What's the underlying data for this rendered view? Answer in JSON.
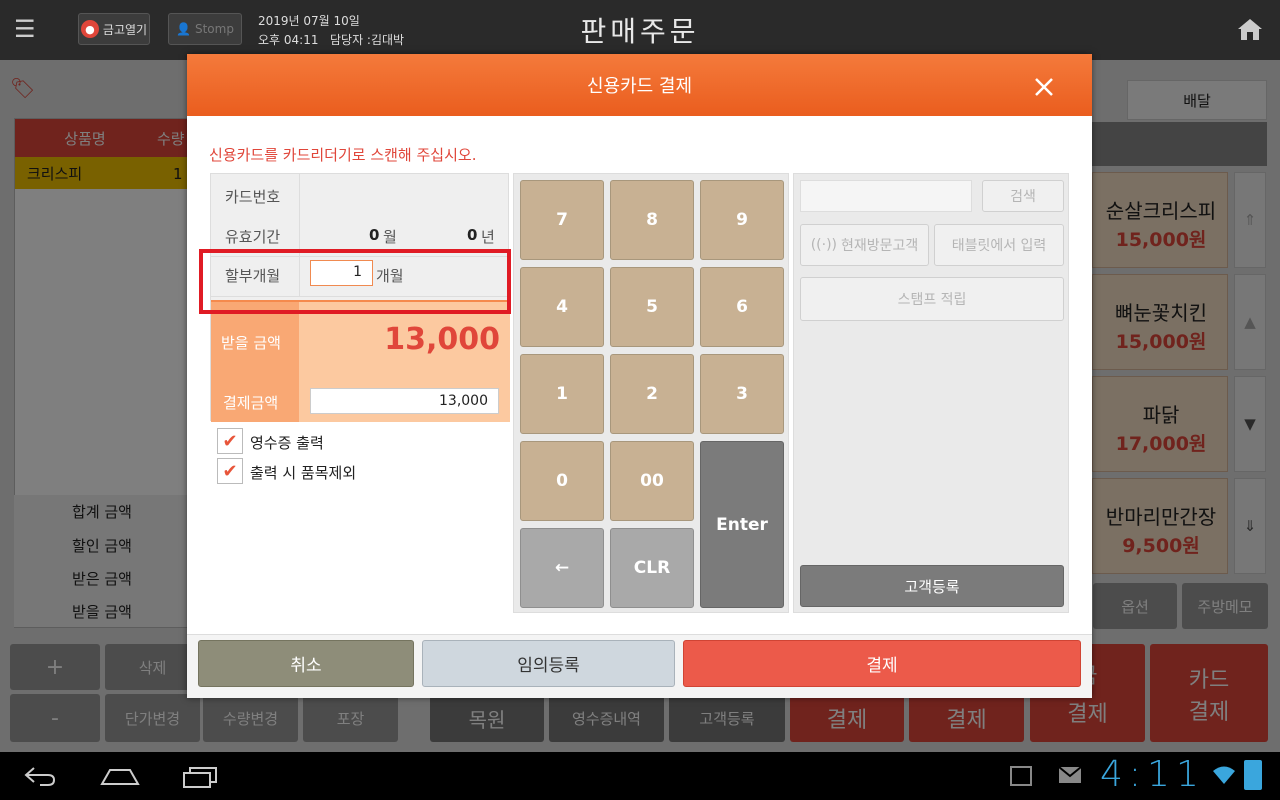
{
  "topbar": {
    "grabber_label": "금고열기",
    "stamp_label": "Stomp",
    "date": "2019년 07월 10일",
    "time": "오후 04:11",
    "staff": "담당자 :김대박",
    "title": "판매주문"
  },
  "background": {
    "tab_delivery": "배달",
    "table_headers": [
      "상품명",
      "수량"
    ],
    "order_row": {
      "name": "크리스피",
      "qty": "1"
    },
    "totals": [
      "합계 금액",
      "할인 금액",
      "받은 금액",
      "받을 금액"
    ],
    "menu_items": [
      {
        "name": "순살크리스피",
        "price": "15,000원"
      },
      {
        "name": "뼈눈꽃치킨",
        "price": "15,000원"
      },
      {
        "name": "파닭",
        "price": "17,000원"
      },
      {
        "name": "반마리만간장",
        "price": "9,500원"
      }
    ],
    "buttons": {
      "plus": "+",
      "minus": "-",
      "delete": "삭제",
      "unit_price": "단가변경",
      "qty_change": "수량변경",
      "pack": "포장",
      "restore": "목원",
      "receipt_history": "영수증내역",
      "customer_reg": "고객등록",
      "option": "옵션",
      "kitchen_memo": "주방메모",
      "pay1": "결제",
      "pay2": "결제",
      "pay3_top": "금",
      "pay3": "결제",
      "card_top": "카드",
      "card": "결제"
    }
  },
  "modal": {
    "title": "신용카드 결제",
    "instruction": "신용카드를 카드리더기로 스캔해 주십시오.",
    "card_number_label": "카드번호",
    "expiry_label": "유효기간",
    "expiry_month": "0",
    "month_unit": "월",
    "expiry_year": "0",
    "year_unit": "년",
    "installment_label": "할부개월",
    "installment_value": "1",
    "installment_unit": "개월",
    "receivable_label": "받을 금액",
    "receivable_amount": "13,000",
    "payment_label": "결제금액",
    "payment_amount": "13,000",
    "receipt_print": "영수증 출력",
    "exclude_items": "출력 시 품목제외",
    "keys": [
      "7",
      "8",
      "9",
      "4",
      "5",
      "6",
      "1",
      "2",
      "3",
      "0",
      "00",
      "Enter",
      "←",
      "CLR"
    ],
    "search_placeholder": "",
    "search_button": "검색",
    "current_customer": "현재방문고객",
    "tablet_input": "태블릿에서 입력",
    "stamp_earn": "스탬프 적립",
    "register_customer": "고객등록",
    "cancel": "취소",
    "arbitrary_reg": "임의등록",
    "pay": "결제"
  },
  "navbar": {
    "clock": "4:11"
  },
  "colors": {
    "accent": "#ea5d1e",
    "highlight_box": "#e01b24",
    "amount_red": "#e0463a",
    "pay_button": "#ec5a4a"
  }
}
